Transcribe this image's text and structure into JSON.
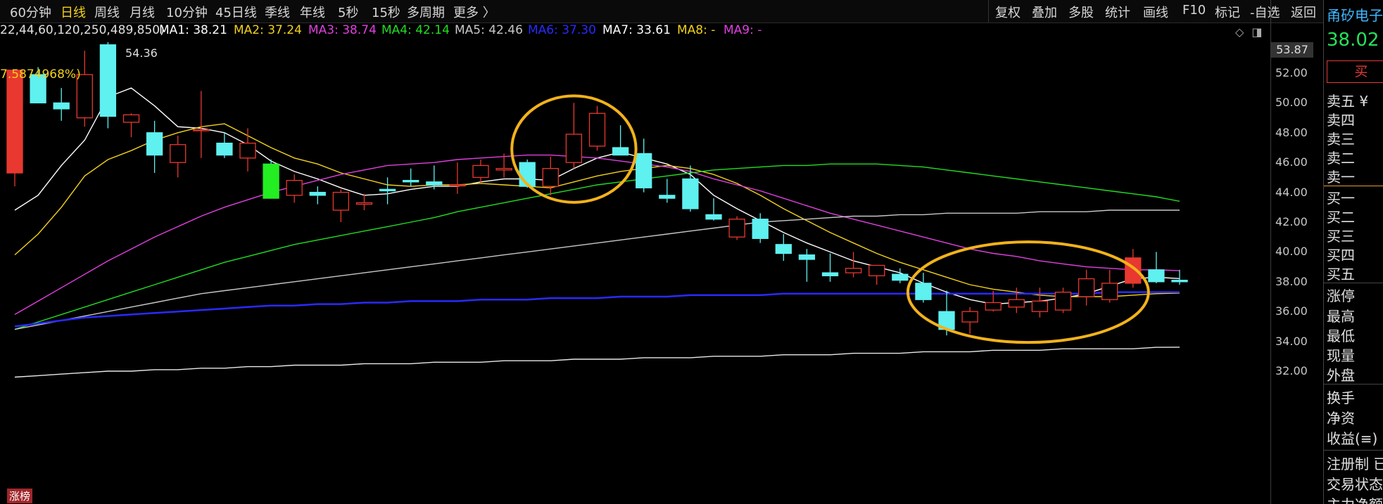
{
  "toolbar": {
    "periods": [
      "60分钟",
      "日线",
      "周线",
      "月线",
      "10分钟",
      "45日线",
      "季线",
      "年线",
      "5秒",
      "15秒",
      "多周期",
      "更多 〉"
    ],
    "active_period": "日线",
    "tools": [
      "复权",
      "叠加",
      "多股",
      "统计",
      "画线",
      "F10",
      "标记",
      "-自选",
      "返回"
    ]
  },
  "ma_legend": {
    "prefix": "22,44,60,120,250,489,850)",
    "items": [
      {
        "label": "MA1: 38.21",
        "color": "#ffffff"
      },
      {
        "label": "MA2: 37.24",
        "color": "#f2d21b"
      },
      {
        "label": "MA3: 38.74",
        "color": "#e040e0"
      },
      {
        "label": "MA4: 42.14",
        "color": "#22dd22"
      },
      {
        "label": "MA5: 42.46",
        "color": "#c8c8c8"
      },
      {
        "label": "MA6: 37.30",
        "color": "#2a2aff"
      },
      {
        "label": "MA7: 33.61",
        "color": "#ffffff"
      },
      {
        "label": "MA8: -",
        "color": "#f2d21b"
      },
      {
        "label": "MA9: -",
        "color": "#e040e0"
      }
    ]
  },
  "annotations": {
    "high_label": "54.36",
    "pct_label": "7.5874968%)",
    "current_price_box": "53.87",
    "zhangbang": "涨榜"
  },
  "sidebar": {
    "stock_name": "甬矽电子",
    "price": "38.02",
    "buy_button": "买",
    "sell_rows": [
      "卖五 ¥",
      "卖四",
      "卖三",
      "卖二",
      "卖一"
    ],
    "buy_rows": [
      "买一",
      "买二",
      "买三",
      "买四",
      "买五"
    ],
    "stat_rows": [
      "涨停",
      "最高",
      "最低",
      "现量",
      "外盘"
    ],
    "stat_rows2": [
      "换手",
      "净资",
      "收益(≡)"
    ],
    "info_rows": [
      "注册制 已",
      "交易状态",
      "主力净额"
    ]
  },
  "colors": {
    "up": "#e8382f",
    "down": "#5ff0f0",
    "ma1": "#ffffff",
    "ma2": "#f2d21b",
    "ma3": "#e040e0",
    "ma4": "#22dd22",
    "ma5": "#c8c8c8",
    "ma6": "#2a2aff",
    "ma7": "#e8e8e8",
    "highlight": "#f2b21b"
  },
  "chart_data": {
    "type": "candlestick",
    "y_ticks": [
      "52.00",
      "50.00",
      "48.00",
      "46.00",
      "44.00",
      "42.00",
      "40.00",
      "38.00",
      "36.00",
      "34.00",
      "32.00"
    ],
    "ylim": [
      31.0,
      54.6
    ],
    "candles": [
      {
        "o": 45.3,
        "h": 50.5,
        "l": 44.4,
        "c": 52.2
      },
      {
        "o": 51.9,
        "h": 52.4,
        "l": 50.0,
        "c": 50.0
      },
      {
        "o": 50.0,
        "h": 51.0,
        "l": 48.8,
        "c": 49.6
      },
      {
        "o": 49.0,
        "h": 53.5,
        "l": 48.4,
        "c": 51.9
      },
      {
        "o": 53.9,
        "h": 54.36,
        "l": 48.3,
        "c": 49.1
      },
      {
        "o": 48.7,
        "h": 49.3,
        "l": 47.7,
        "c": 49.2
      },
      {
        "o": 48.0,
        "h": 48.8,
        "l": 45.3,
        "c": 46.5
      },
      {
        "o": 46.0,
        "h": 47.8,
        "l": 45.0,
        "c": 47.2
      },
      {
        "o": 48.2,
        "h": 50.8,
        "l": 46.3,
        "c": 48.2
      },
      {
        "o": 47.3,
        "h": 48.0,
        "l": 46.3,
        "c": 46.5
      },
      {
        "o": 46.3,
        "h": 48.3,
        "l": 45.4,
        "c": 47.3
      },
      {
        "o": 45.9,
        "h": 46.2,
        "l": 43.6,
        "c": 43.6
      },
      {
        "o": 43.8,
        "h": 45.2,
        "l": 43.3,
        "c": 44.8
      },
      {
        "o": 44.0,
        "h": 44.4,
        "l": 43.2,
        "c": 43.8
      },
      {
        "o": 42.8,
        "h": 44.2,
        "l": 42.0,
        "c": 44.0
      },
      {
        "o": 43.2,
        "h": 43.9,
        "l": 42.8,
        "c": 43.3
      },
      {
        "o": 44.2,
        "h": 45.0,
        "l": 43.2,
        "c": 44.1
      },
      {
        "o": 44.8,
        "h": 45.6,
        "l": 44.4,
        "c": 44.7
      },
      {
        "o": 44.7,
        "h": 45.8,
        "l": 44.2,
        "c": 44.5
      },
      {
        "o": 44.5,
        "h": 46.0,
        "l": 43.9,
        "c": 44.5
      },
      {
        "o": 45.0,
        "h": 46.2,
        "l": 44.6,
        "c": 45.8
      },
      {
        "o": 45.5,
        "h": 46.6,
        "l": 45.0,
        "c": 45.6
      },
      {
        "o": 46.0,
        "h": 46.2,
        "l": 44.3,
        "c": 44.4
      },
      {
        "o": 44.4,
        "h": 46.4,
        "l": 43.8,
        "c": 45.6
      },
      {
        "o": 46.0,
        "h": 50.0,
        "l": 45.6,
        "c": 47.9
      },
      {
        "o": 47.1,
        "h": 49.8,
        "l": 46.8,
        "c": 49.3
      },
      {
        "o": 47.0,
        "h": 48.5,
        "l": 46.5,
        "c": 46.5
      },
      {
        "o": 46.6,
        "h": 47.6,
        "l": 44.0,
        "c": 44.3
      },
      {
        "o": 43.8,
        "h": 44.9,
        "l": 43.3,
        "c": 43.6
      },
      {
        "o": 44.9,
        "h": 45.8,
        "l": 42.7,
        "c": 42.9
      },
      {
        "o": 42.5,
        "h": 43.6,
        "l": 42.1,
        "c": 42.2
      },
      {
        "o": 41.0,
        "h": 42.4,
        "l": 40.8,
        "c": 42.2
      },
      {
        "o": 42.2,
        "h": 42.6,
        "l": 40.6,
        "c": 40.9
      },
      {
        "o": 40.5,
        "h": 41.2,
        "l": 39.4,
        "c": 39.9
      },
      {
        "o": 39.8,
        "h": 40.2,
        "l": 38.0,
        "c": 39.5
      },
      {
        "o": 38.6,
        "h": 39.9,
        "l": 38.0,
        "c": 38.4
      },
      {
        "o": 38.6,
        "h": 40.0,
        "l": 38.3,
        "c": 38.9
      },
      {
        "o": 38.4,
        "h": 39.0,
        "l": 37.8,
        "c": 39.1
      },
      {
        "o": 38.5,
        "h": 38.9,
        "l": 37.9,
        "c": 38.1
      },
      {
        "o": 37.9,
        "h": 38.6,
        "l": 36.6,
        "c": 36.8
      },
      {
        "o": 36.0,
        "h": 37.4,
        "l": 34.4,
        "c": 34.8
      },
      {
        "o": 35.3,
        "h": 36.3,
        "l": 34.5,
        "c": 36.0
      },
      {
        "o": 36.1,
        "h": 37.4,
        "l": 36.0,
        "c": 36.6
      },
      {
        "o": 36.3,
        "h": 37.6,
        "l": 35.9,
        "c": 36.8
      },
      {
        "o": 36.0,
        "h": 37.6,
        "l": 35.6,
        "c": 36.7
      },
      {
        "o": 36.1,
        "h": 37.6,
        "l": 35.9,
        "c": 37.3
      },
      {
        "o": 37.0,
        "h": 38.8,
        "l": 36.4,
        "c": 38.2
      },
      {
        "o": 36.8,
        "h": 38.8,
        "l": 36.6,
        "c": 37.9
      },
      {
        "o": 37.9,
        "h": 40.2,
        "l": 37.6,
        "c": 39.6
      },
      {
        "o": 38.8,
        "h": 40.0,
        "l": 37.9,
        "c": 38.0
      },
      {
        "o": 38.1,
        "h": 38.8,
        "l": 37.8,
        "c": 38.0
      }
    ],
    "ma_lines": [
      {
        "name": "MA1",
        "color": "#ffffff",
        "values": [
          42.8,
          43.8,
          45.8,
          47.5,
          50.4,
          51.0,
          49.8,
          48.4,
          48.3,
          48.0,
          47.2,
          46.1,
          45.4,
          44.9,
          44.3,
          43.8,
          43.9,
          44.2,
          44.4,
          44.4,
          44.7,
          44.9,
          44.9,
          44.8,
          45.6,
          46.3,
          46.7,
          46.3,
          45.9,
          45.2,
          43.8,
          42.9,
          42.1,
          41.3,
          40.6,
          40.0,
          39.4,
          39.0,
          38.6,
          37.9,
          37.3,
          36.8,
          36.5,
          36.6,
          36.7,
          36.9,
          37.2,
          37.7,
          38.2,
          38.3,
          38.21
        ]
      },
      {
        "name": "MA2",
        "color": "#f2d21b",
        "values": [
          39.8,
          41.2,
          43.0,
          45.1,
          46.2,
          46.8,
          47.5,
          48.0,
          48.4,
          48.6,
          47.8,
          47.0,
          46.3,
          45.9,
          45.3,
          44.9,
          44.5,
          44.4,
          44.5,
          44.5,
          44.6,
          44.5,
          44.4,
          44.3,
          44.7,
          45.1,
          45.4,
          45.6,
          45.8,
          45.6,
          45.2,
          44.6,
          43.8,
          42.9,
          42.1,
          41.3,
          40.6,
          39.9,
          39.3,
          38.8,
          38.3,
          37.8,
          37.5,
          37.3,
          37.1,
          37.0,
          37.0,
          37.0,
          37.1,
          37.2,
          37.24
        ]
      },
      {
        "name": "MA3",
        "color": "#e040e0",
        "values": [
          35.8,
          36.7,
          37.6,
          38.5,
          39.4,
          40.2,
          41.0,
          41.7,
          42.4,
          43.0,
          43.5,
          44.0,
          44.4,
          44.8,
          45.2,
          45.5,
          45.8,
          45.9,
          46.0,
          46.2,
          46.3,
          46.4,
          46.5,
          46.5,
          46.4,
          46.3,
          46.1,
          45.9,
          45.7,
          45.4,
          44.9,
          44.5,
          44.1,
          43.6,
          43.1,
          42.6,
          42.2,
          41.8,
          41.4,
          41.0,
          40.6,
          40.2,
          39.9,
          39.7,
          39.4,
          39.2,
          39.0,
          38.9,
          38.8,
          38.8,
          38.74
        ]
      },
      {
        "name": "MA4",
        "color": "#22dd22",
        "values": [
          34.8,
          35.3,
          35.8,
          36.3,
          36.8,
          37.3,
          37.8,
          38.3,
          38.8,
          39.3,
          39.7,
          40.1,
          40.5,
          40.8,
          41.1,
          41.4,
          41.7,
          42.0,
          42.3,
          42.7,
          43.0,
          43.3,
          43.6,
          43.9,
          44.2,
          44.5,
          44.7,
          44.9,
          45.1,
          45.3,
          45.5,
          45.6,
          45.7,
          45.8,
          45.8,
          45.9,
          45.9,
          45.9,
          45.8,
          45.7,
          45.5,
          45.3,
          45.1,
          44.9,
          44.7,
          44.5,
          44.3,
          44.1,
          43.9,
          43.7,
          43.4
        ]
      },
      {
        "name": "MA5",
        "color": "#c8c8c8",
        "values": [
          34.8,
          35.1,
          35.4,
          35.7,
          36.0,
          36.3,
          36.6,
          36.9,
          37.2,
          37.4,
          37.6,
          37.8,
          38.0,
          38.2,
          38.4,
          38.6,
          38.8,
          39.0,
          39.2,
          39.4,
          39.6,
          39.8,
          40.0,
          40.2,
          40.4,
          40.6,
          40.8,
          41.0,
          41.2,
          41.4,
          41.6,
          41.8,
          42.0,
          42.1,
          42.2,
          42.3,
          42.4,
          42.4,
          42.5,
          42.5,
          42.6,
          42.6,
          42.6,
          42.6,
          42.7,
          42.7,
          42.7,
          42.8,
          42.8,
          42.8,
          42.8
        ]
      },
      {
        "name": "MA6",
        "color": "#2a2aff",
        "values": [
          35.0,
          35.2,
          35.4,
          35.6,
          35.7,
          35.8,
          35.9,
          36.0,
          36.1,
          36.2,
          36.3,
          36.4,
          36.4,
          36.5,
          36.5,
          36.6,
          36.6,
          36.7,
          36.7,
          36.7,
          36.8,
          36.8,
          36.8,
          36.9,
          36.9,
          36.9,
          37.0,
          37.0,
          37.0,
          37.1,
          37.1,
          37.1,
          37.1,
          37.2,
          37.2,
          37.2,
          37.2,
          37.2,
          37.2,
          37.2,
          37.2,
          37.2,
          37.2,
          37.2,
          37.2,
          37.2,
          37.2,
          37.3,
          37.3,
          37.3,
          37.3
        ]
      },
      {
        "name": "MA7",
        "color": "#e8e8e8",
        "values": [
          31.6,
          31.7,
          31.8,
          31.9,
          32.0,
          32.0,
          32.1,
          32.1,
          32.2,
          32.2,
          32.3,
          32.3,
          32.4,
          32.4,
          32.4,
          32.5,
          32.5,
          32.5,
          32.6,
          32.6,
          32.6,
          32.7,
          32.7,
          32.7,
          32.8,
          32.8,
          32.8,
          32.9,
          32.9,
          32.9,
          33.0,
          33.0,
          33.0,
          33.1,
          33.1,
          33.1,
          33.2,
          33.2,
          33.2,
          33.3,
          33.3,
          33.3,
          33.4,
          33.4,
          33.4,
          33.5,
          33.5,
          33.5,
          33.5,
          33.6,
          33.61
        ]
      }
    ],
    "highlight_ellipses": [
      {
        "from_index": 22,
        "to_index": 26
      },
      {
        "from_index": 39,
        "to_index": 48
      }
    ]
  }
}
